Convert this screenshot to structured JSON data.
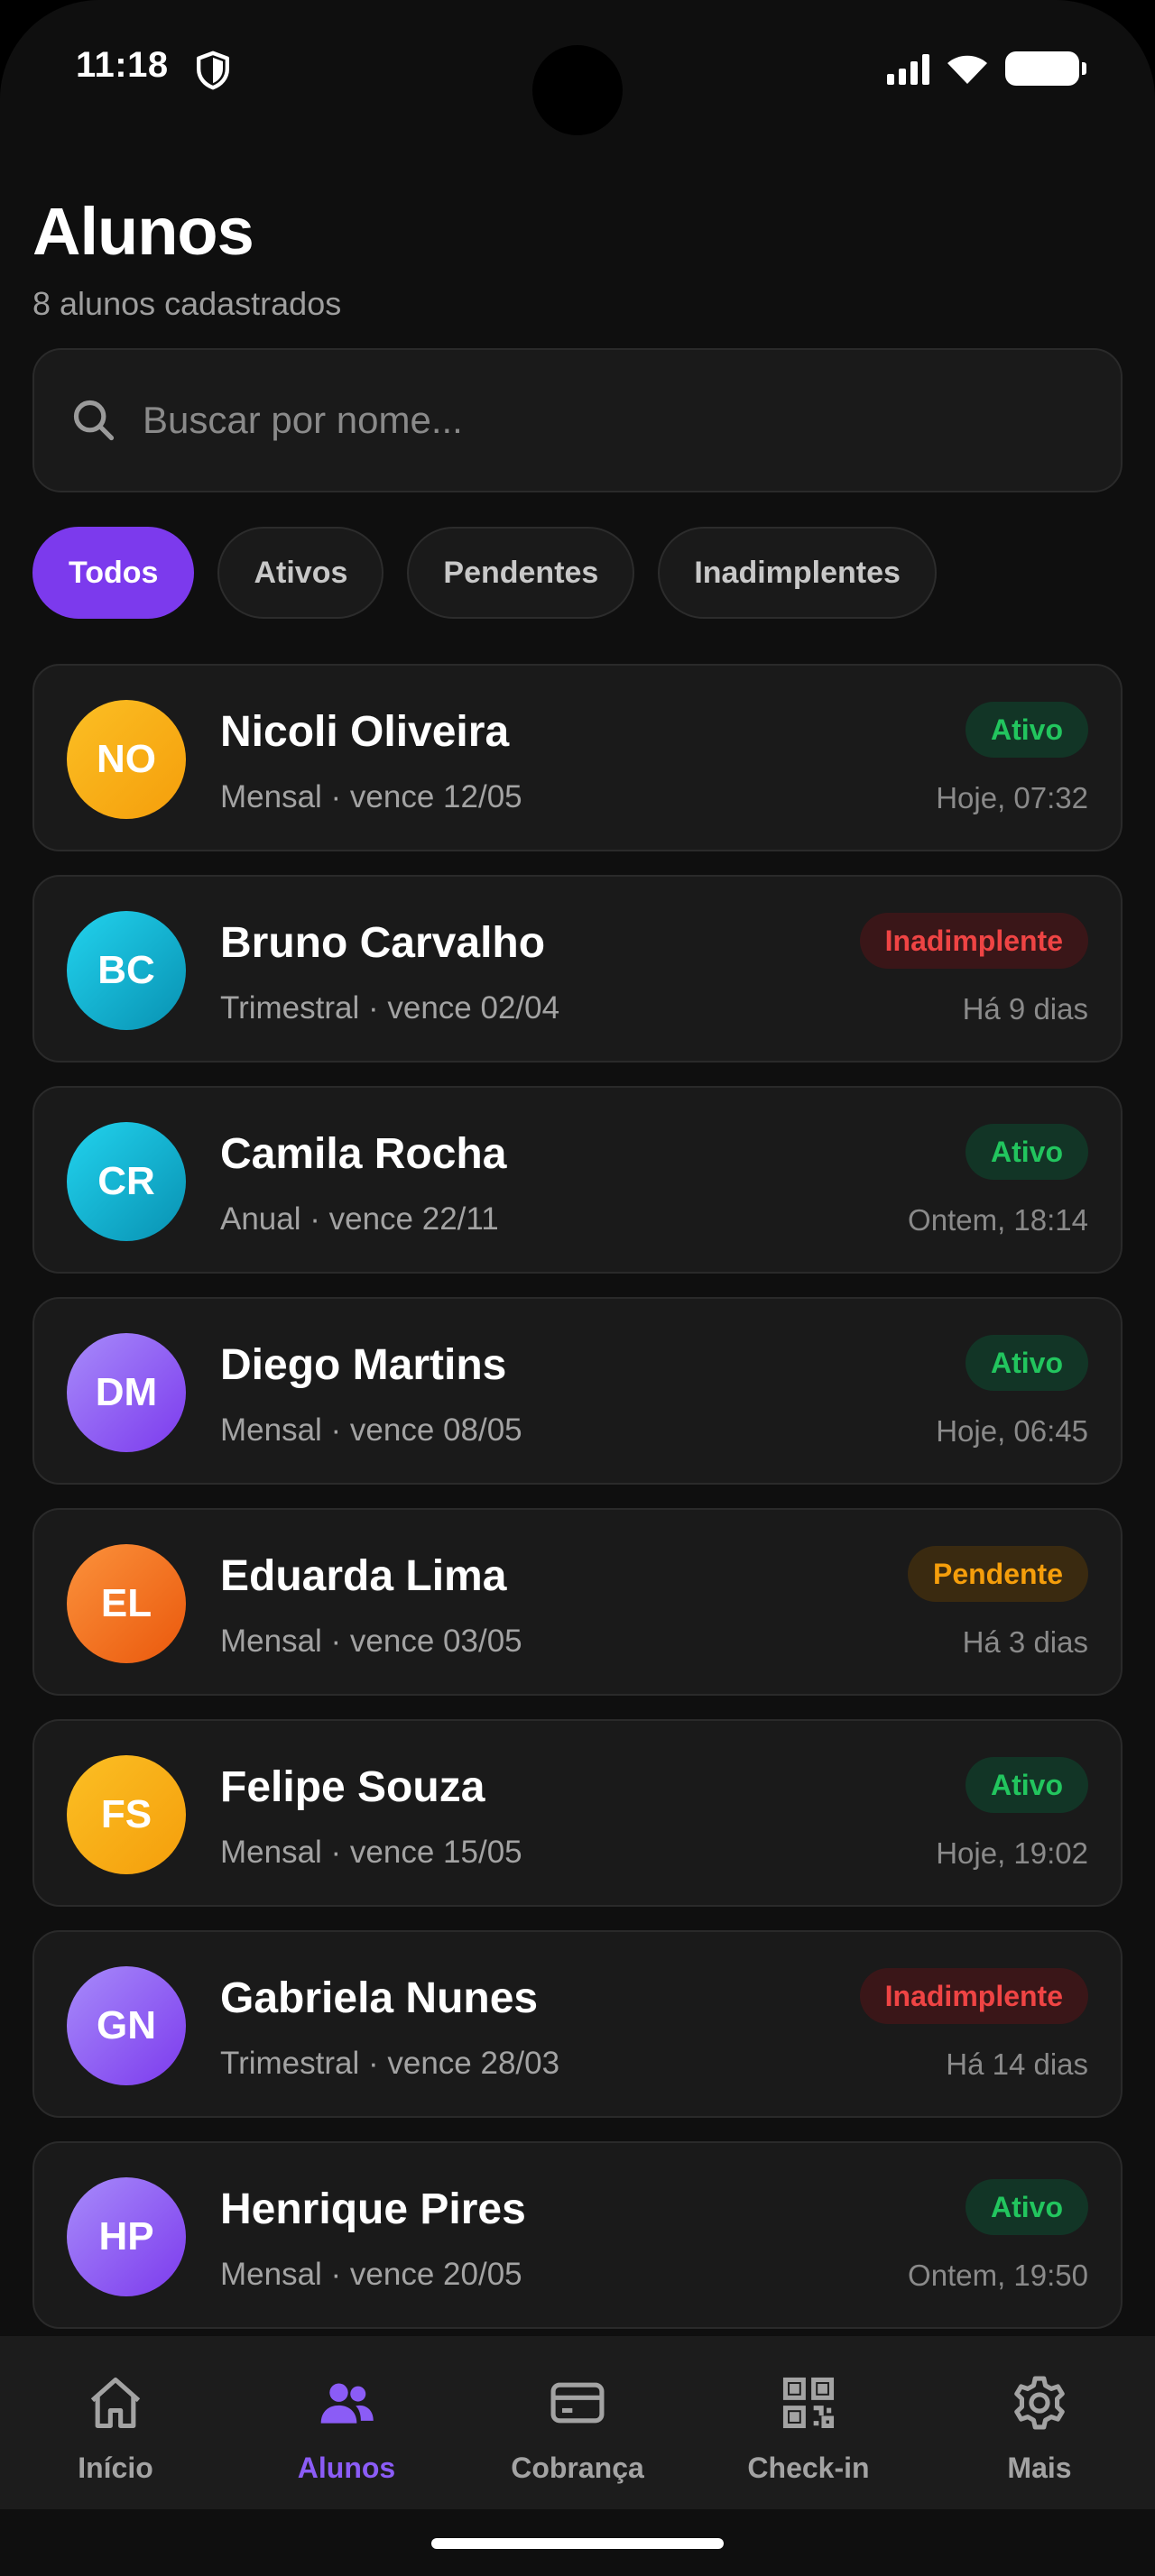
{
  "status_bar": {
    "time": "11:18"
  },
  "header": {
    "title": "Alunos",
    "subtitle": "8 alunos cadastrados"
  },
  "search": {
    "placeholder": "Buscar por nome..."
  },
  "filters": [
    {
      "label": "Todos",
      "active": true
    },
    {
      "label": "Ativos",
      "active": false
    },
    {
      "label": "Pendentes",
      "active": false
    },
    {
      "label": "Inadimplentes",
      "active": false
    }
  ],
  "students": [
    {
      "initials": "NO",
      "name": "Nicoli Oliveira",
      "plan": "Mensal · vence 12/05",
      "status": "Ativo",
      "when": "Hoje, 07:32",
      "avatar_color": "#f59e0b"
    },
    {
      "initials": "BC",
      "name": "Bruno Carvalho",
      "plan": "Trimestral · vence 02/04",
      "status": "Inadimplente",
      "when": "Há 9 dias",
      "avatar_color": "#06b6d4"
    },
    {
      "initials": "CR",
      "name": "Camila Rocha",
      "plan": "Anual · vence 22/11",
      "status": "Ativo",
      "when": "Ontem, 18:14",
      "avatar_color": "#06b6d4"
    },
    {
      "initials": "DM",
      "name": "Diego Martins",
      "plan": "Mensal · vence 08/05",
      "status": "Ativo",
      "when": "Hoje, 06:45",
      "avatar_color": "#8b5cf6"
    },
    {
      "initials": "EL",
      "name": "Eduarda Lima",
      "plan": "Mensal · vence 03/05",
      "status": "Pendente",
      "when": "Há 3 dias",
      "avatar_color": "#f97316"
    },
    {
      "initials": "FS",
      "name": "Felipe Souza",
      "plan": "Mensal · vence 15/05",
      "status": "Ativo",
      "when": "Hoje, 19:02",
      "avatar_color": "#f59e0b"
    },
    {
      "initials": "GN",
      "name": "Gabriela Nunes",
      "plan": "Trimestral · vence 28/03",
      "status": "Inadimplente",
      "when": "Há 14 dias",
      "avatar_color": "#8b5cf6"
    },
    {
      "initials": "HP",
      "name": "Henrique Pires",
      "plan": "Mensal · vence 20/05",
      "status": "Ativo",
      "when": "Ontem, 19:50",
      "avatar_color": "#8b5cf6"
    }
  ],
  "bottom_nav": [
    {
      "label": "Início",
      "icon": "home-icon",
      "active": false
    },
    {
      "label": "Alunos",
      "icon": "users-icon",
      "active": true
    },
    {
      "label": "Cobrança",
      "icon": "card-icon",
      "active": false
    },
    {
      "label": "Check-in",
      "icon": "qr-code-icon",
      "active": false
    },
    {
      "label": "Mais",
      "icon": "gear-icon",
      "active": false
    }
  ],
  "colors": {
    "accent": "#7c3aed",
    "accent_text": "#8b5cf6",
    "background": "#0f0f0f",
    "card": "#1a1a1a"
  }
}
